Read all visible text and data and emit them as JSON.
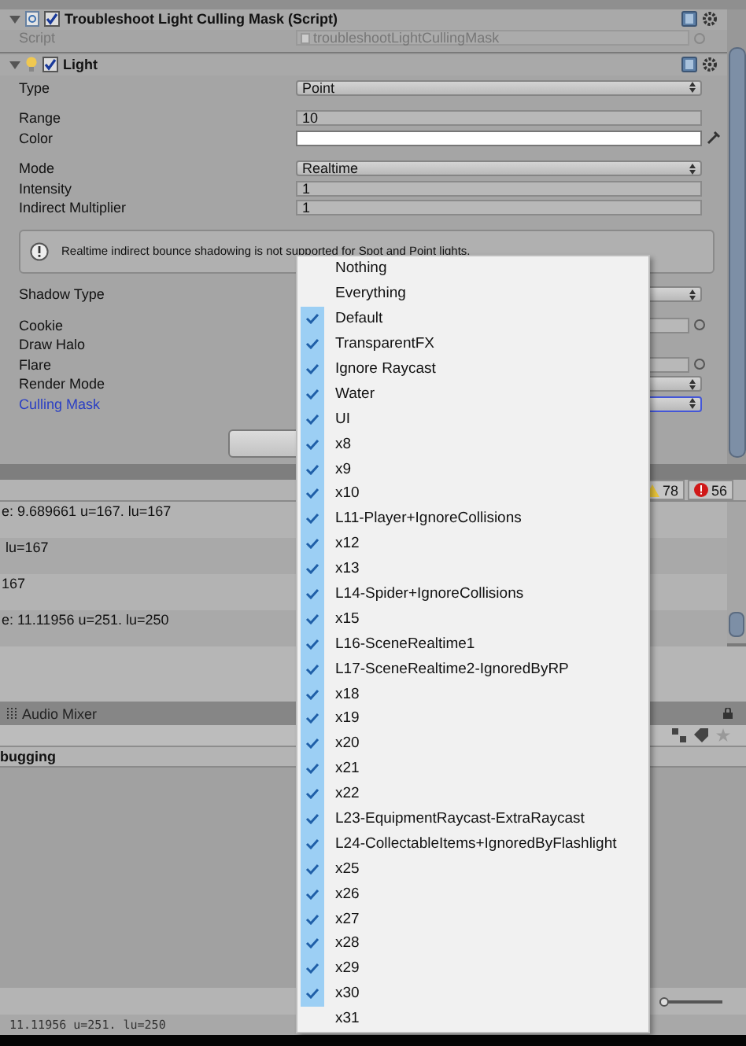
{
  "script_component": {
    "title": "Troubleshoot Light Culling Mask (Script)",
    "enabled": true,
    "script_field": {
      "label": "Script",
      "value": "troubleshootLightCullingMask",
      "disabled": true
    }
  },
  "light_component": {
    "title": "Light",
    "enabled": true,
    "groups": [
      {
        "kind": "fields",
        "rows": [
          {
            "kind": "dropdown",
            "label": "Type",
            "value": "Point",
            "focused": false
          }
        ]
      },
      {
        "kind": "fields",
        "rows": [
          {
            "kind": "text",
            "label": "Range",
            "value": "10",
            "focused": false
          },
          {
            "kind": "color",
            "label": "Color",
            "focused": false
          }
        ]
      },
      {
        "kind": "fields",
        "rows": [
          {
            "kind": "dropdown",
            "label": "Mode",
            "value": "Realtime",
            "focused": false
          },
          {
            "kind": "text",
            "label": "Intensity",
            "value": "1",
            "focused": false
          },
          {
            "kind": "text",
            "label": "Indirect Multiplier",
            "value": "1",
            "focused": false
          }
        ]
      },
      {
        "kind": "help",
        "text": "Realtime indirect bounce shadowing is not supported for Spot and Point lights."
      },
      {
        "kind": "fields",
        "rows": [
          {
            "kind": "dropdown",
            "label": "Shadow Type",
            "focused": false
          }
        ]
      },
      {
        "kind": "fields",
        "rows": [
          {
            "kind": "object",
            "label": "Cookie",
            "focused": false
          },
          {
            "kind": "label",
            "label": "Draw Halo",
            "focused": false
          },
          {
            "kind": "object",
            "label": "Flare",
            "focused": false
          },
          {
            "kind": "dropdown",
            "label": "Render Mode",
            "focused": false
          },
          {
            "kind": "dropdown",
            "label": "Culling Mask",
            "focused": true
          }
        ]
      }
    ]
  },
  "console": {
    "warnings": "78",
    "errors": "56",
    "rows": [
      {
        "text": "e: 9.689661 u=167. lu=167"
      },
      {
        "text": " lu=167"
      },
      {
        "text": "167"
      },
      {
        "text": "e: 11.11956 u=251. lu=250"
      }
    ]
  },
  "bottom_panel": {
    "tab": {
      "label": "Audio Mixer"
    },
    "section": "bugging",
    "zoom_slider": {
      "level": 0
    }
  },
  "status_bar": "11.11956 u=251. lu=250",
  "culling_mask_menu": {
    "items": [
      {
        "label": "Nothing",
        "checked": false
      },
      {
        "label": "Everything",
        "checked": false
      },
      {
        "label": "Default",
        "checked": true
      },
      {
        "label": "TransparentFX",
        "checked": true
      },
      {
        "label": "Ignore Raycast",
        "checked": true
      },
      {
        "label": "Water",
        "checked": true
      },
      {
        "label": "UI",
        "checked": true
      },
      {
        "label": "x8",
        "checked": true
      },
      {
        "label": "x9",
        "checked": true
      },
      {
        "label": "x10",
        "checked": true
      },
      {
        "label": "L11-Player+IgnoreCollisions",
        "checked": true
      },
      {
        "label": "x12",
        "checked": true
      },
      {
        "label": "x13",
        "checked": true
      },
      {
        "label": "L14-Spider+IgnoreCollisions",
        "checked": true
      },
      {
        "label": "x15",
        "checked": true
      },
      {
        "label": "L16-SceneRealtime1",
        "checked": true
      },
      {
        "label": "L17-SceneRealtime2-IgnoredByRP",
        "checked": true
      },
      {
        "label": "x18",
        "checked": true
      },
      {
        "label": "x19",
        "checked": true
      },
      {
        "label": "x20",
        "checked": true
      },
      {
        "label": "x21",
        "checked": true
      },
      {
        "label": "x22",
        "checked": true
      },
      {
        "label": "L23-EquipmentRaycast-ExtraRaycast",
        "checked": true
      },
      {
        "label": "L24-CollectableItems+IgnoredByFlashlight",
        "checked": true
      },
      {
        "label": "x25",
        "checked": true
      },
      {
        "label": "x26",
        "checked": true
      },
      {
        "label": "x27",
        "checked": true
      },
      {
        "label": "x28",
        "checked": true
      },
      {
        "label": "x29",
        "checked": true
      },
      {
        "label": "x30",
        "checked": true
      },
      {
        "label": "x31",
        "checked": false
      }
    ]
  }
}
